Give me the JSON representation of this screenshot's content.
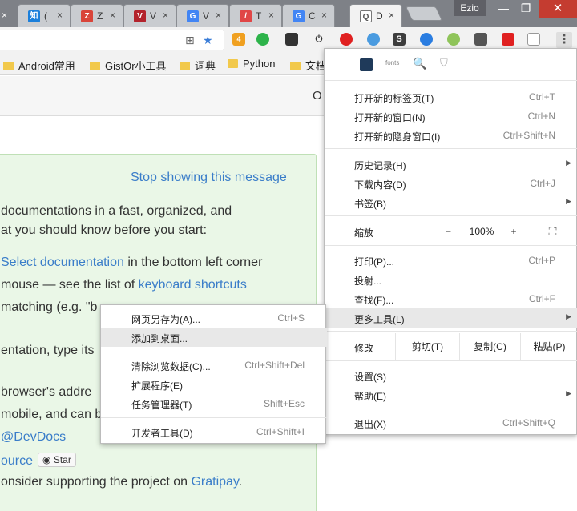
{
  "tabs": [
    {
      "favicon": "知",
      "favicon_color": "#1a7fdb",
      "title": "(",
      "close": "×"
    },
    {
      "favicon": "Z",
      "favicon_color": "#d9453a",
      "title": "Z",
      "close": "×"
    },
    {
      "favicon": "V",
      "favicon_color": "#b3232c",
      "title": "V",
      "close": "×"
    },
    {
      "favicon": "G",
      "favicon_color": "#4285f4",
      "title": "V",
      "close": "×"
    },
    {
      "favicon": "/",
      "favicon_color": "#e04646",
      "title": "T",
      "close": "×"
    },
    {
      "favicon": "G",
      "favicon_color": "#4285f4",
      "title": "C",
      "close": "×"
    },
    {
      "favicon": "Q",
      "favicon_color": "#5b5b5b",
      "title": "D",
      "close": "×"
    }
  ],
  "window": {
    "profile": "Ezio",
    "minimize": "—",
    "maximize": "❐",
    "close": "✕"
  },
  "toolbar": {
    "translate_icon": "⊞",
    "star_icon": "★",
    "badge_count": "4",
    "menu_dots": "⋮"
  },
  "bookmarks": [
    "Android常用",
    "GistOr小工具",
    "词典",
    "Python",
    "文档"
  ],
  "page": {
    "header_letter": "O",
    "stop_message": "Stop showing this message",
    "lines": [
      "documentations in a fast, organized, and",
      "at you should know before you start:"
    ],
    "select_doc_link": "Select documentation",
    "select_doc_rest": " in the bottom left corner",
    "mouse_text": "mouse — see the list of ",
    "shortcuts_link": "keyboard shortcuts",
    "matching_text": "matching (e.g. \"b",
    "entation_text": "entation, type its",
    "browser_text": "browser's addre",
    "mobile_text": "mobile, and can b",
    "devdocs_link": "@DevDocs",
    "source_link": "ource",
    "star_button": "Star",
    "consider_text": "onsider supporting the project on ",
    "gratipay_link": "Gratipay",
    "period": "."
  },
  "menu": {
    "ext_fonts": "fonts",
    "items1": [
      {
        "label": "打开新的标签页(T)",
        "shortcut": "Ctrl+T"
      },
      {
        "label": "打开新的窗口(N)",
        "shortcut": "Ctrl+N"
      },
      {
        "label": "打开新的隐身窗口(I)",
        "shortcut": "Ctrl+Shift+N"
      }
    ],
    "items2": [
      {
        "label": "历史记录(H)",
        "shortcut": ""
      },
      {
        "label": "下载内容(D)",
        "shortcut": "Ctrl+J"
      },
      {
        "label": "书签(B)",
        "shortcut": ""
      }
    ],
    "zoom": {
      "label": "缩放",
      "minus": "−",
      "value": "100%",
      "plus": "+",
      "fullscreen": "⛶"
    },
    "items3": [
      {
        "label": "打印(P)...",
        "shortcut": "Ctrl+P"
      },
      {
        "label": "投射...",
        "shortcut": ""
      },
      {
        "label": "查找(F)...",
        "shortcut": "Ctrl+F"
      },
      {
        "label": "更多工具(L)",
        "shortcut": ""
      }
    ],
    "edit": {
      "label": "修改",
      "cut": "剪切(T)",
      "copy": "复制(C)",
      "paste": "粘贴(P)"
    },
    "items4": [
      {
        "label": "设置(S)",
        "shortcut": ""
      },
      {
        "label": "帮助(E)",
        "shortcut": ""
      }
    ],
    "exit": {
      "label": "退出(X)",
      "shortcut": "Ctrl+Shift+Q"
    },
    "arrow": "▶"
  },
  "submenu": {
    "items": [
      {
        "label": "网页另存为(A)...",
        "shortcut": "Ctrl+S"
      },
      {
        "label": "添加到桌面...",
        "shortcut": ""
      },
      {
        "label": "清除浏览数据(C)...",
        "shortcut": "Ctrl+Shift+Del"
      },
      {
        "label": "扩展程序(E)",
        "shortcut": ""
      },
      {
        "label": "任务管理器(T)",
        "shortcut": "Shift+Esc"
      },
      {
        "label": "开发者工具(D)",
        "shortcut": "Ctrl+Shift+I"
      }
    ]
  }
}
